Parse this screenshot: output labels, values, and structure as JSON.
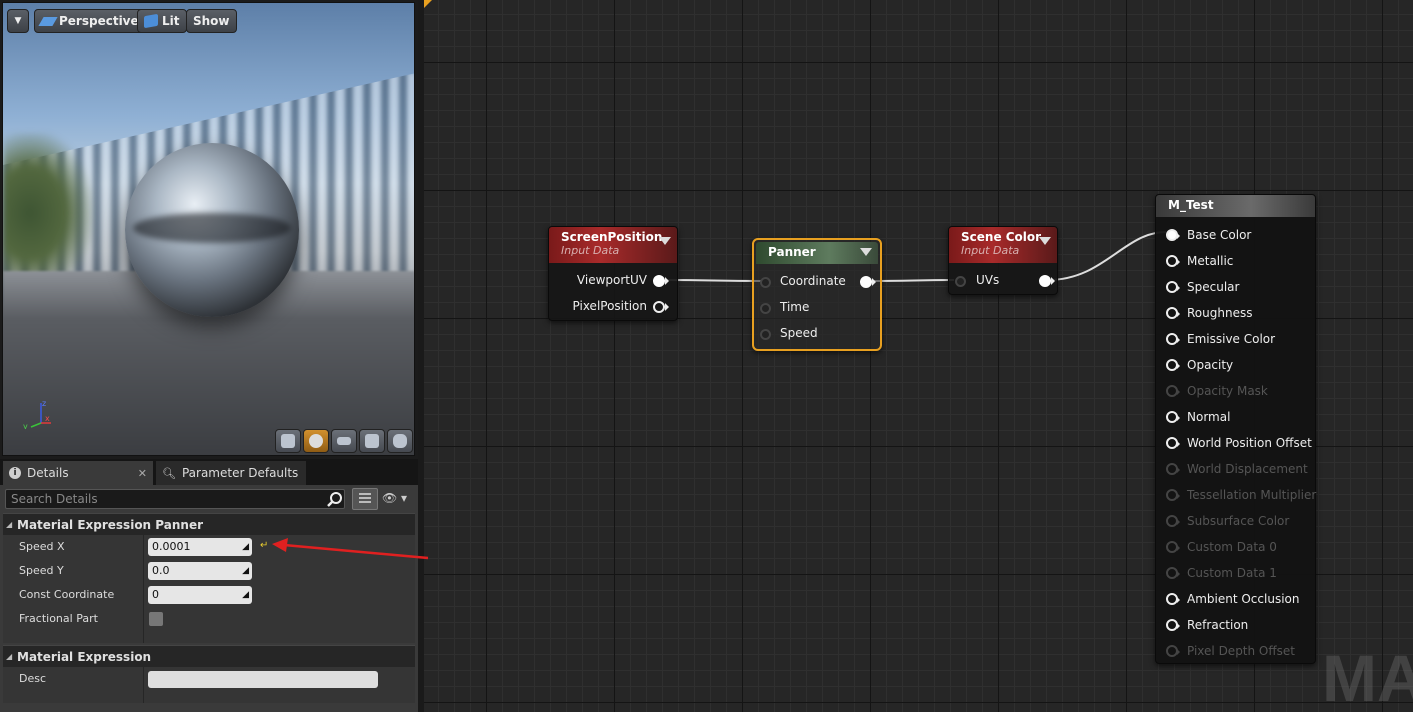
{
  "viewport": {
    "menu_icon": "chevron-down-icon",
    "perspective_label": "Perspective",
    "lit_label": "Lit",
    "show_label": "Show",
    "axes": {
      "x": "x",
      "y": "y",
      "z": "z"
    }
  },
  "details": {
    "tabs": [
      {
        "label": "Details",
        "icon": "info-icon"
      },
      {
        "label": "Parameter Defaults",
        "icon": "search-icon"
      }
    ],
    "search_placeholder": "Search Details",
    "categories": [
      {
        "title": "Material Expression Panner",
        "properties": [
          {
            "label": "Speed X",
            "value": "0.0001"
          },
          {
            "label": "Speed Y",
            "value": "0.0"
          },
          {
            "label": "Const Coordinate",
            "value": "0"
          },
          {
            "label": "Fractional Part",
            "value": "unchecked"
          }
        ]
      },
      {
        "title": "Material Expression",
        "properties": [
          {
            "label": "Desc",
            "value": ""
          }
        ]
      }
    ]
  },
  "graph": {
    "watermark": "MAT",
    "nodes": {
      "screen_position": {
        "title": "ScreenPosition",
        "subtitle": "Input Data",
        "outputs": [
          "ViewportUV",
          "PixelPosition"
        ]
      },
      "panner": {
        "title": "Panner",
        "inputs": [
          "Coordinate",
          "Time",
          "Speed"
        ]
      },
      "scene_color": {
        "title": "Scene Color",
        "subtitle": "Input Data",
        "inputs": [
          "UVs"
        ]
      },
      "m_test": {
        "title": "M_Test",
        "inputs": [
          {
            "label": "Base Color",
            "enabled": true,
            "connected": true
          },
          {
            "label": "Metallic",
            "enabled": true,
            "connected": false
          },
          {
            "label": "Specular",
            "enabled": true,
            "connected": false
          },
          {
            "label": "Roughness",
            "enabled": true,
            "connected": false
          },
          {
            "label": "Emissive Color",
            "enabled": true,
            "connected": false
          },
          {
            "label": "Opacity",
            "enabled": true,
            "connected": false
          },
          {
            "label": "Opacity Mask",
            "enabled": false,
            "connected": false
          },
          {
            "label": "Normal",
            "enabled": true,
            "connected": false
          },
          {
            "label": "World Position Offset",
            "enabled": true,
            "connected": false
          },
          {
            "label": "World Displacement",
            "enabled": false,
            "connected": false
          },
          {
            "label": "Tessellation Multiplier",
            "enabled": false,
            "connected": false
          },
          {
            "label": "Subsurface Color",
            "enabled": false,
            "connected": false
          },
          {
            "label": "Custom Data 0",
            "enabled": false,
            "connected": false
          },
          {
            "label": "Custom Data 1",
            "enabled": false,
            "connected": false
          },
          {
            "label": "Ambient Occlusion",
            "enabled": true,
            "connected": false
          },
          {
            "label": "Refraction",
            "enabled": true,
            "connected": false
          },
          {
            "label": "Pixel Depth Offset",
            "enabled": false,
            "connected": false
          }
        ]
      }
    }
  },
  "colors": {
    "selection_orange": "#e8a020",
    "annotation_red": "#e02020",
    "input_node_red": "#a82a2a",
    "panner_green": "#5e7b5e"
  }
}
